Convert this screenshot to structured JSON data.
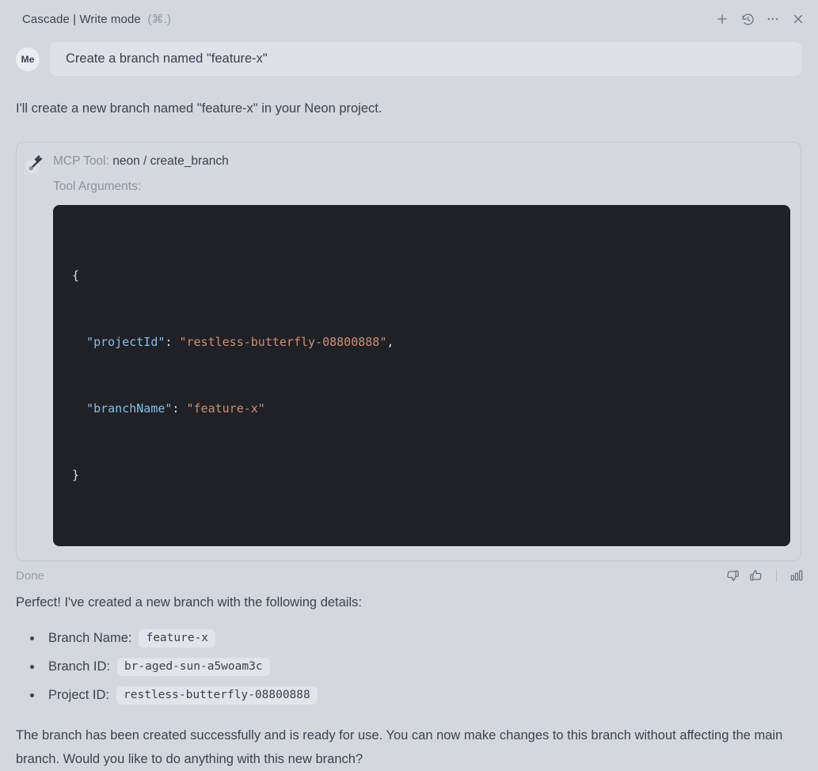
{
  "header": {
    "title": "Cascade | Write mode",
    "shortcut": "(⌘.)"
  },
  "user_message": {
    "avatar": "Me",
    "text": "Create a branch named \"feature-x\""
  },
  "assistant": {
    "intro": "I'll create a new branch named \"feature-x\" in your Neon project.",
    "result_heading": "Perfect! I've created a new branch with the following details:",
    "details": [
      {
        "label": "Branch Name:",
        "code": "feature-x"
      },
      {
        "label": "Branch ID:",
        "code": "br-aged-sun-a5woam3c"
      },
      {
        "label": "Project ID:",
        "code": "restless-butterfly-08800888"
      }
    ],
    "closing": "The branch has been created successfully and is ready for use. You can now make changes to this branch without affecting the main branch. Would you like to do anything with this new branch?"
  },
  "tool_card": {
    "label": "MCP Tool:",
    "tool_name": "neon / create_branch",
    "args_label": "Tool Arguments:",
    "code": {
      "open_brace": "{",
      "close_brace": "}",
      "lines": [
        {
          "key": "\"projectId\"",
          "sep": ": ",
          "value": "\"restless-butterfly-08800888\"",
          "comma": ","
        },
        {
          "key": "\"branchName\"",
          "sep": ": ",
          "value": "\"feature-x\"",
          "comma": ""
        }
      ]
    }
  },
  "footer": {
    "status": "Done"
  },
  "colors": {
    "background": "#d5d7de",
    "bubble": "#dfe0e8",
    "code_background": "#202126",
    "code_key": "#85bfe9",
    "code_string": "#c98f75",
    "text": "#3d4250",
    "muted_text": "#8c919d"
  }
}
